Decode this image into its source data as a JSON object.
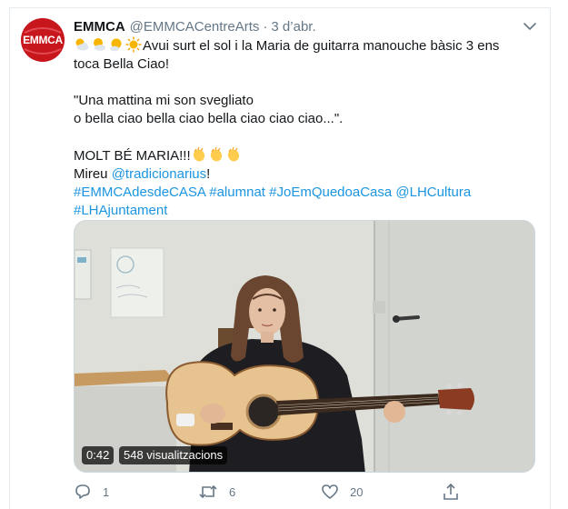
{
  "account": {
    "avatar_text": "EMMCA",
    "name": "EMMCA",
    "handle": "@EMMCACentreArts",
    "separator": "·",
    "date": "3 d’abr."
  },
  "tweet": {
    "line1": "Avui surt el sol i la Maria de guitarra manouche bàsic 3 ens",
    "line2": "toca Bella Ciao!",
    "line3": "\"Una mattina mi son svegliato",
    "line4": "o bella ciao bella ciao bella ciao ciao ciao...\".",
    "line5": "MOLT BÉ MARIA!!!",
    "line6_prefix": "Mireu ",
    "line6_mention": "@tradicionarius",
    "line6_suffix": "!",
    "hashtags": [
      "#EMMCAdesdeCASA",
      "#alumnat",
      "#JoEmQuedoaCasa",
      "@LHCultura"
    ],
    "hashtag_last": "#LHAjuntament",
    "weather_emojis": [
      "sun-behind-cloud-icon",
      "sun-behind-cloud-icon",
      "sun-behind-small-cloud-icon",
      "sun-icon"
    ],
    "clap_emojis": [
      "clapping-hands-icon",
      "clapping-hands-icon",
      "clapping-hands-icon"
    ]
  },
  "video": {
    "duration": "0:42",
    "views": "548 visualitzacions"
  },
  "actions": {
    "replies": "1",
    "retweets": "6",
    "likes": "20"
  },
  "colors": {
    "link": "#1b95e0",
    "secondary_text": "#657786",
    "brand": "#c8161d"
  }
}
